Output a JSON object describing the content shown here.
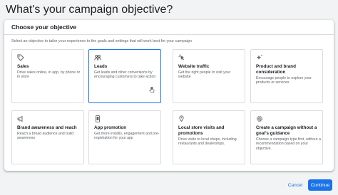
{
  "page": {
    "title": "What's your campaign objective?"
  },
  "panel": {
    "title": "Choose your objective",
    "description": "Select an objective to tailor your experience to the goals and settings that will work best for your campaign"
  },
  "objectives": [
    {
      "icon": "tag-icon",
      "title": "Sales",
      "description": "Drive sales online, in app, by phone or in store",
      "selected": false
    },
    {
      "icon": "people-icon",
      "title": "Leads",
      "description": "Get leads and other conversions by encouraging customers to take action",
      "selected": true
    },
    {
      "icon": "cursor-click-icon",
      "title": "Website traffic",
      "description": "Get the right people to visit your website",
      "selected": false
    },
    {
      "icon": "sparkle-icon",
      "title": "Product and brand consideration",
      "description": "Encourage people to explore your products or services",
      "selected": false
    },
    {
      "icon": "megaphone-icon",
      "title": "Brand awareness and reach",
      "description": "Reach a broad audience and build awareness",
      "selected": false
    },
    {
      "icon": "phone-icon",
      "title": "App promotion",
      "description": "Get more installs, engagement and pre-registration for your app",
      "selected": false
    },
    {
      "icon": "store-icon",
      "title": "Local store visits and promotions",
      "description": "Drive visits to local shops, including restaurants and dealerships.",
      "selected": false
    },
    {
      "icon": "gear-icon",
      "title": "Create a campaign without a goal's guidance",
      "description": "Choose a campaign type first, without a recommendation based on your objective.",
      "selected": false
    }
  ],
  "footer": {
    "cancel_label": "Cancel",
    "continue_label": "Continue"
  },
  "colors": {
    "accent": "#1a73e8",
    "background": "#f1f3f4",
    "card_border": "#dadce0",
    "secondary_text": "#5f6368"
  }
}
